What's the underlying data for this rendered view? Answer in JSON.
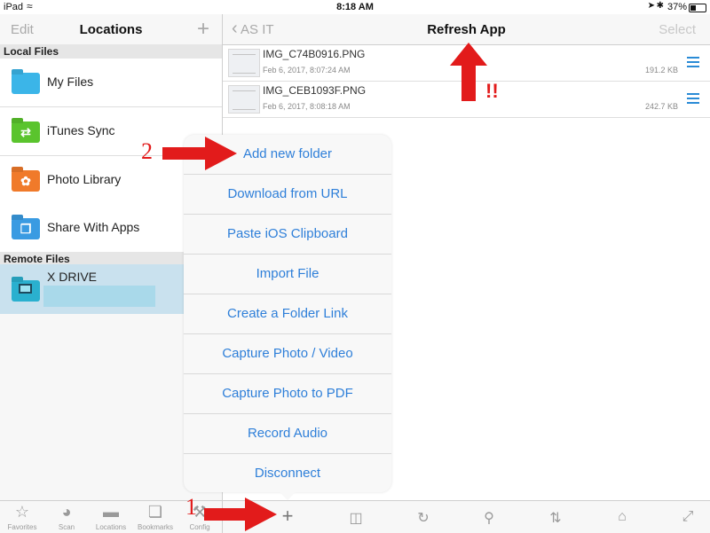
{
  "status_bar": {
    "device": "iPad",
    "time": "8:18 AM",
    "battery": "37%"
  },
  "left_nav": {
    "edit_label": "Edit",
    "title": "Locations",
    "add_label": "+"
  },
  "sections": {
    "local": "Local Files",
    "remote": "Remote Files"
  },
  "locations": [
    {
      "label": "My Files",
      "color": "#3bb5e8",
      "icon": "folder-icon"
    },
    {
      "label": "iTunes Sync",
      "color": "#5ac42d",
      "icon": "sync-folder-icon"
    },
    {
      "label": "Photo Library",
      "color": "#f07a2a",
      "icon": "photo-folder-icon"
    },
    {
      "label": "Share With Apps",
      "color": "#3a9be2",
      "icon": "share-folder-icon"
    }
  ],
  "remote": {
    "label": "X DRIVE",
    "color": "#2ab0cf",
    "icon": "server-folder-icon"
  },
  "right_nav": {
    "back_label": "AS IT",
    "title": "Refresh App",
    "select_label": "Select"
  },
  "files": [
    {
      "name": "IMG_C74B0916.PNG",
      "date": "Feb 6, 2017, 8:07:24 AM",
      "size": "191.2 KB"
    },
    {
      "name": "IMG_CEB1093F.PNG",
      "date": "Feb 6, 2017, 8:08:18 AM",
      "size": "242.7 KB"
    }
  ],
  "popover_menu": [
    "Add new folder",
    "Download from URL",
    "Paste iOS Clipboard",
    "Import File",
    "Create a Folder Link",
    "Capture Photo / Video",
    "Capture Photo to PDF",
    "Record Audio",
    "Disconnect"
  ],
  "tabs": [
    {
      "label": "Favorites",
      "icon": "star-icon"
    },
    {
      "label": "Scan",
      "icon": "scan-icon"
    },
    {
      "label": "Locations",
      "icon": "folder-icon"
    },
    {
      "label": "Bookmarks",
      "icon": "book-icon"
    },
    {
      "label": "Config",
      "icon": "wrench-icon"
    }
  ],
  "annotations": {
    "step1": "1",
    "step2": "2",
    "warning": "!!"
  },
  "colors": {
    "accent": "#2e7fd9",
    "annotation": "#e21b1b",
    "selected_row": "#c9e1ee"
  }
}
